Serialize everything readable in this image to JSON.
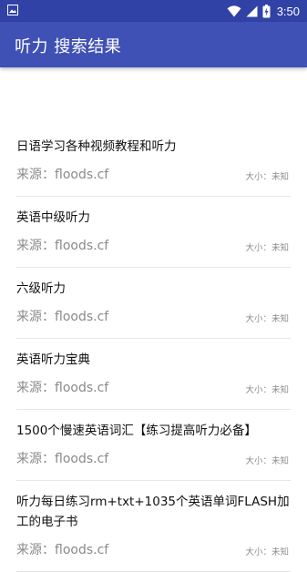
{
  "status_bar": {
    "time": "3:50",
    "icons": [
      "image-icon",
      "wifi-icon",
      "signal-icon",
      "battery-charging-icon"
    ]
  },
  "app_bar": {
    "title": "听力 搜索结果",
    "color": "#3f51b5",
    "status_color": "#3142a6"
  },
  "results": [
    {
      "title": "日语学习各种视频教程和听力",
      "source": "来源：floods.cf",
      "size": "大小：未知"
    },
    {
      "title": "英语中级听力",
      "source": "来源：floods.cf",
      "size": "大小：未知"
    },
    {
      "title": "六级听力",
      "source": "来源：floods.cf",
      "size": "大小：未知"
    },
    {
      "title": "英语听力宝典",
      "source": "来源：floods.cf",
      "size": "大小：未知"
    },
    {
      "title": "1500个慢速英语词汇【练习提高听力必备】",
      "source": "来源：floods.cf",
      "size": "大小：未知"
    },
    {
      "title": "听力每日练习rm+txt+1035个英语单词FLASH加工的电子书",
      "source": "来源：floods.cf",
      "size": "大小：未知"
    }
  ]
}
